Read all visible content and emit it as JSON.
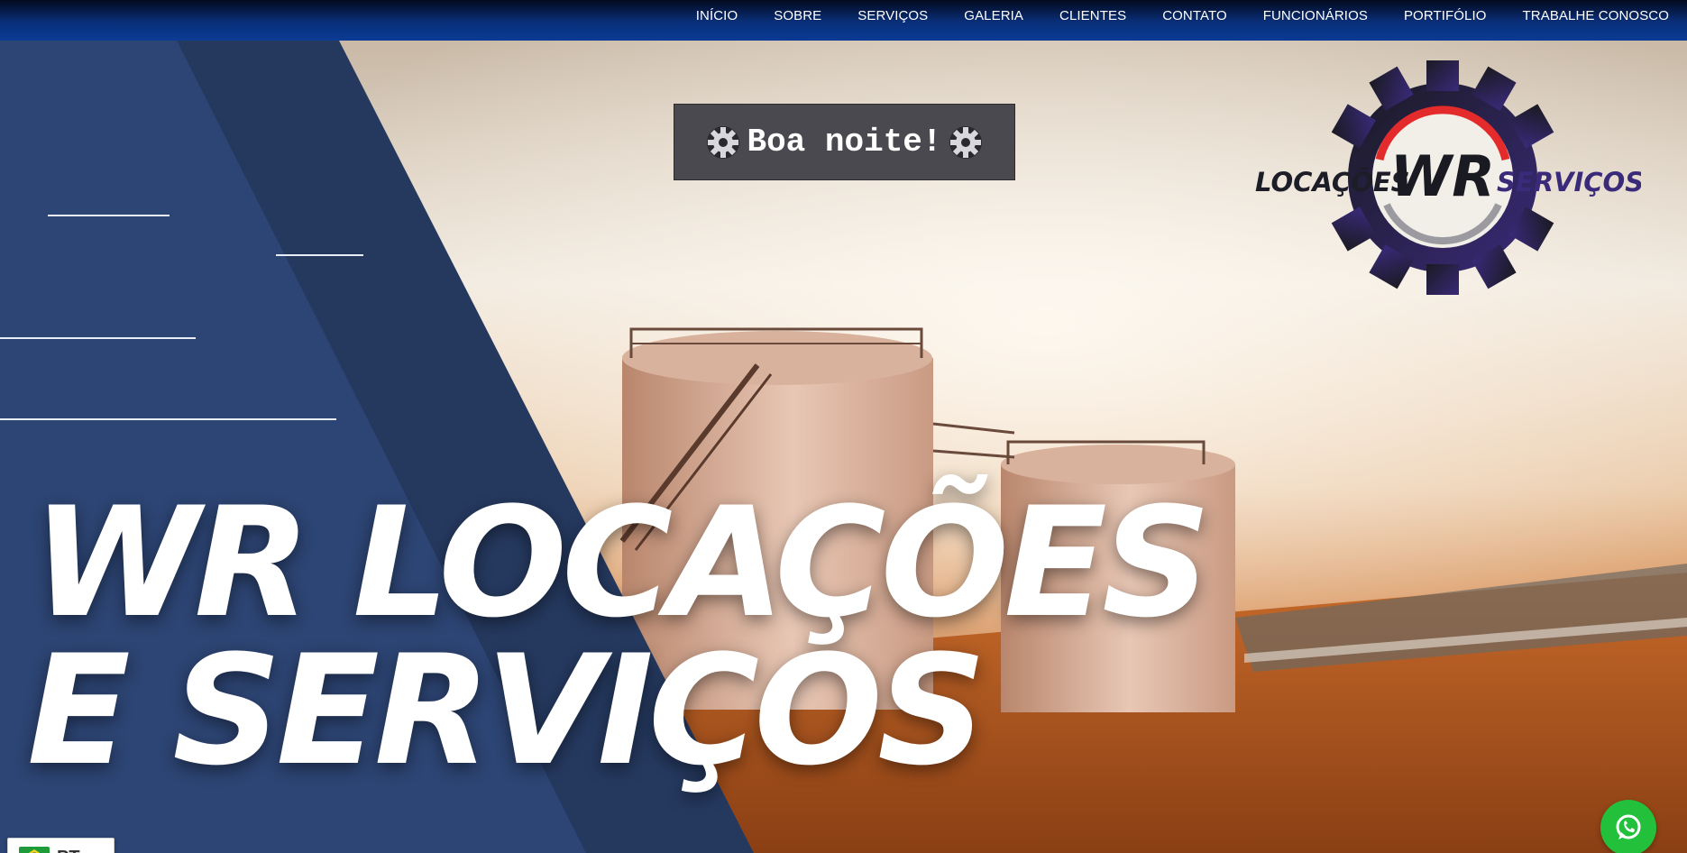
{
  "nav": {
    "items": [
      {
        "label": "INÍCIO"
      },
      {
        "label": "SOBRE"
      },
      {
        "label": "SERVIÇOS"
      },
      {
        "label": "GALERIA"
      },
      {
        "label": "CLIENTES"
      },
      {
        "label": "CONTATO"
      },
      {
        "label": "FUNCIONÁRIOS"
      },
      {
        "label": "PORTIFÓLIO"
      },
      {
        "label": "TRABALHE CONOSCO"
      }
    ]
  },
  "greeting": {
    "text": "Boa noite!"
  },
  "logo": {
    "left_text": "LOCAÇÕES",
    "monogram": "WR",
    "right_text": "SERVIÇOS"
  },
  "hero": {
    "headline_line1": "WR LOCAÇÕES",
    "headline_line2": "E SERVIÇOS"
  },
  "language": {
    "code": "PT"
  },
  "icons": {
    "greeting": "gear-icon",
    "chat": "whatsapp-icon",
    "flag": "brazil-flag-icon",
    "caret": "chevron-up-icon"
  },
  "colors": {
    "nav": "#0b3b95",
    "panel_dark": "#25395f",
    "panel_light": "#2d4574",
    "whatsapp": "#23c03b",
    "logo_red": "#e32b2b",
    "logo_purple": "#3a2a7a"
  }
}
